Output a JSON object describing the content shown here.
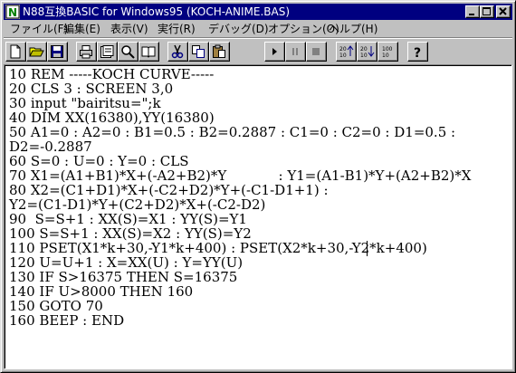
{
  "window": {
    "title": "N88互換BASIC for Windows95 (KOCH-ANIME.BAS)"
  },
  "caption_buttons": [
    "minimize-button",
    "maximize-button",
    "close-button"
  ],
  "menu": [
    {
      "label": "ファイル(F)"
    },
    {
      "label": "編集(E)"
    },
    {
      "label": "表示(V)"
    },
    {
      "label": "実行(R)"
    },
    {
      "label": "デバッグ(D)"
    },
    {
      "label": "オプション(O)"
    },
    {
      "label": "ヘルプ(H)"
    }
  ],
  "toolbar": [
    {
      "name": "new-file",
      "icon": "new-file-icon"
    },
    {
      "name": "open-file",
      "icon": "open-folder-icon"
    },
    {
      "name": "save-file",
      "icon": "floppy-disk-icon"
    },
    {
      "name": "print",
      "icon": "printer-icon"
    },
    {
      "name": "print-preview",
      "icon": "print-preview-icon"
    },
    {
      "name": "find",
      "icon": "magnifier-icon"
    },
    {
      "name": "view-book",
      "icon": "book-icon"
    },
    {
      "name": "cut",
      "icon": "scissors-icon"
    },
    {
      "name": "copy",
      "icon": "copy-icon"
    },
    {
      "name": "paste",
      "icon": "clipboard-icon"
    },
    {
      "name": "run",
      "icon": "play-icon"
    },
    {
      "name": "pause",
      "icon": "pause-icon"
    },
    {
      "name": "stop",
      "icon": "stop-icon"
    },
    {
      "name": "sort-ascending",
      "icon": "sort-ascending-icon"
    },
    {
      "name": "sort-descending",
      "icon": "sort-descending-icon"
    },
    {
      "name": "renumber",
      "icon": "renumber-icon"
    },
    {
      "name": "help",
      "icon": "question-mark-icon"
    }
  ],
  "code_lines": [
    "10 REM -----KOCH CURVE-----",
    "20 CLS 3 : SCREEN 3,0",
    "30 input \"bairitsu=\";k",
    "40 DIM XX(16380),YY(16380)",
    "50 A1=0 : A2=0 : B1=0.5 : B2=0.2887 : C1=0 : C2=0 : D1=0.5 :",
    "D2=-0.2887",
    "60 S=0 : U=0 : Y=0 : CLS",
    "70 X1=(A1+B1)*X+(-A2+B2)*Y            : Y1=(A1-B1)*Y+(A2+B2)*X",
    "80 X2=(C1+D1)*X+(-C2+D2)*Y+(-C1-D1+1) :",
    "Y2=(C1-D1)*Y+(C2+D2)*X+(-C2-D2)",
    "90  S=S+1 : XX(S)=X1 : YY(S)=Y1",
    "100 S=S+1 : XX(S)=X2 : YY(S)=Y2",
    "110 PSET(X1*k+30,-Y1*k+400) : PSET(X2*k+30,-Y2*k+400)",
    "120 U=U+1 : X=XX(U) : Y=YY(U)",
    "130 IF S>16375 THEN S=16375",
    "140 IF U>8000 THEN 160",
    "150 GOTO 70",
    "160 BEEP : END"
  ]
}
